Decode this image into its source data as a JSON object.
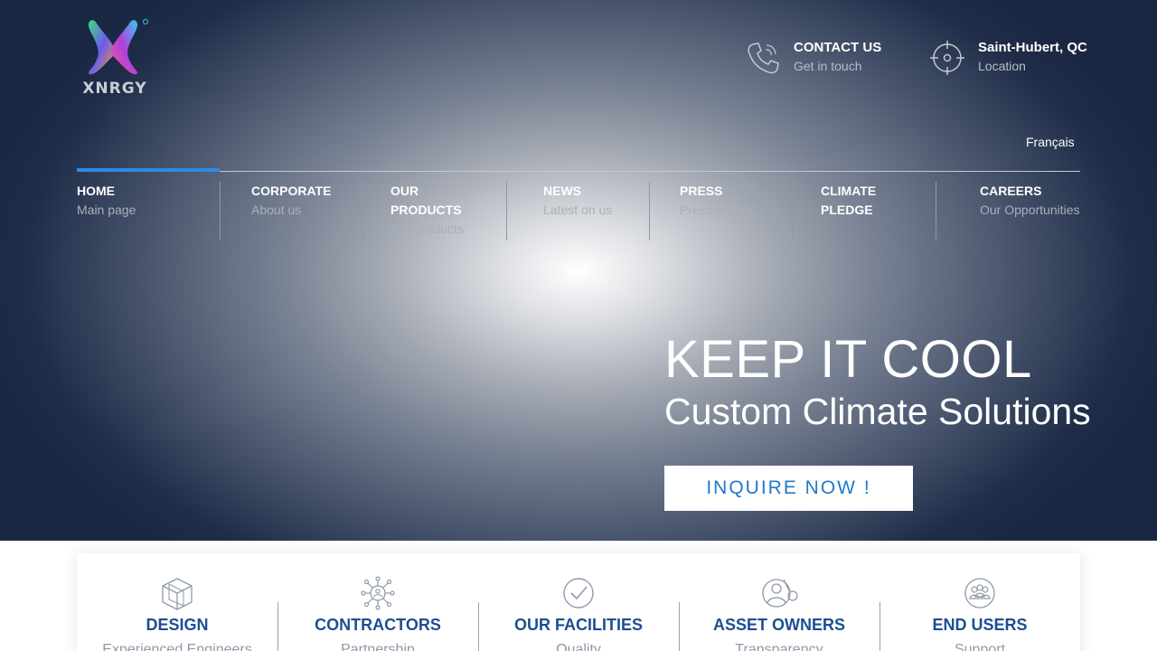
{
  "header": {
    "logo_text": "XNRGY",
    "contact": {
      "title": "CONTACT US",
      "sub": "Get in touch",
      "icon": "phone-icon"
    },
    "location": {
      "title": "Saint-Hubert, QC",
      "sub": "Location",
      "icon": "crosshair-icon"
    },
    "language": "Français"
  },
  "nav": {
    "items": [
      {
        "title": "HOME",
        "sub": "Main page"
      },
      {
        "title": "CORPORATE",
        "sub": "About us"
      },
      {
        "title": "OUR PRODUCTS",
        "sub": "Our products"
      },
      {
        "title": "NEWS",
        "sub": "Latest on us"
      },
      {
        "title": "PRESS",
        "sub": "Press releases"
      },
      {
        "title": "CLIMATE PLEDGE",
        "sub": ""
      },
      {
        "title": "CAREERS",
        "sub": "Our Opportunities"
      }
    ]
  },
  "hero": {
    "title": "KEEP IT COOL",
    "subtitle": "Custom Climate Solutions",
    "cta": "INQUIRE NOW !"
  },
  "cards": {
    "items": [
      {
        "title": "DESIGN",
        "sub": "Experienced Engineers",
        "icon": "cube-icon"
      },
      {
        "title": "CONTRACTORS",
        "sub": "Partnership",
        "icon": "network-icon"
      },
      {
        "title": "OUR FACILITIES",
        "sub": "Quality",
        "icon": "checkmark-icon"
      },
      {
        "title": "ASSET OWNERS",
        "sub": "Transparency",
        "icon": "user-search-icon"
      },
      {
        "title": "END USERS",
        "sub": "Support",
        "icon": "group-icon"
      }
    ]
  },
  "colors": {
    "accent": "#2d8ae0",
    "card_title": "#1d4e93",
    "cta_text": "#2479c9",
    "hero_dark": "#1a2742"
  }
}
